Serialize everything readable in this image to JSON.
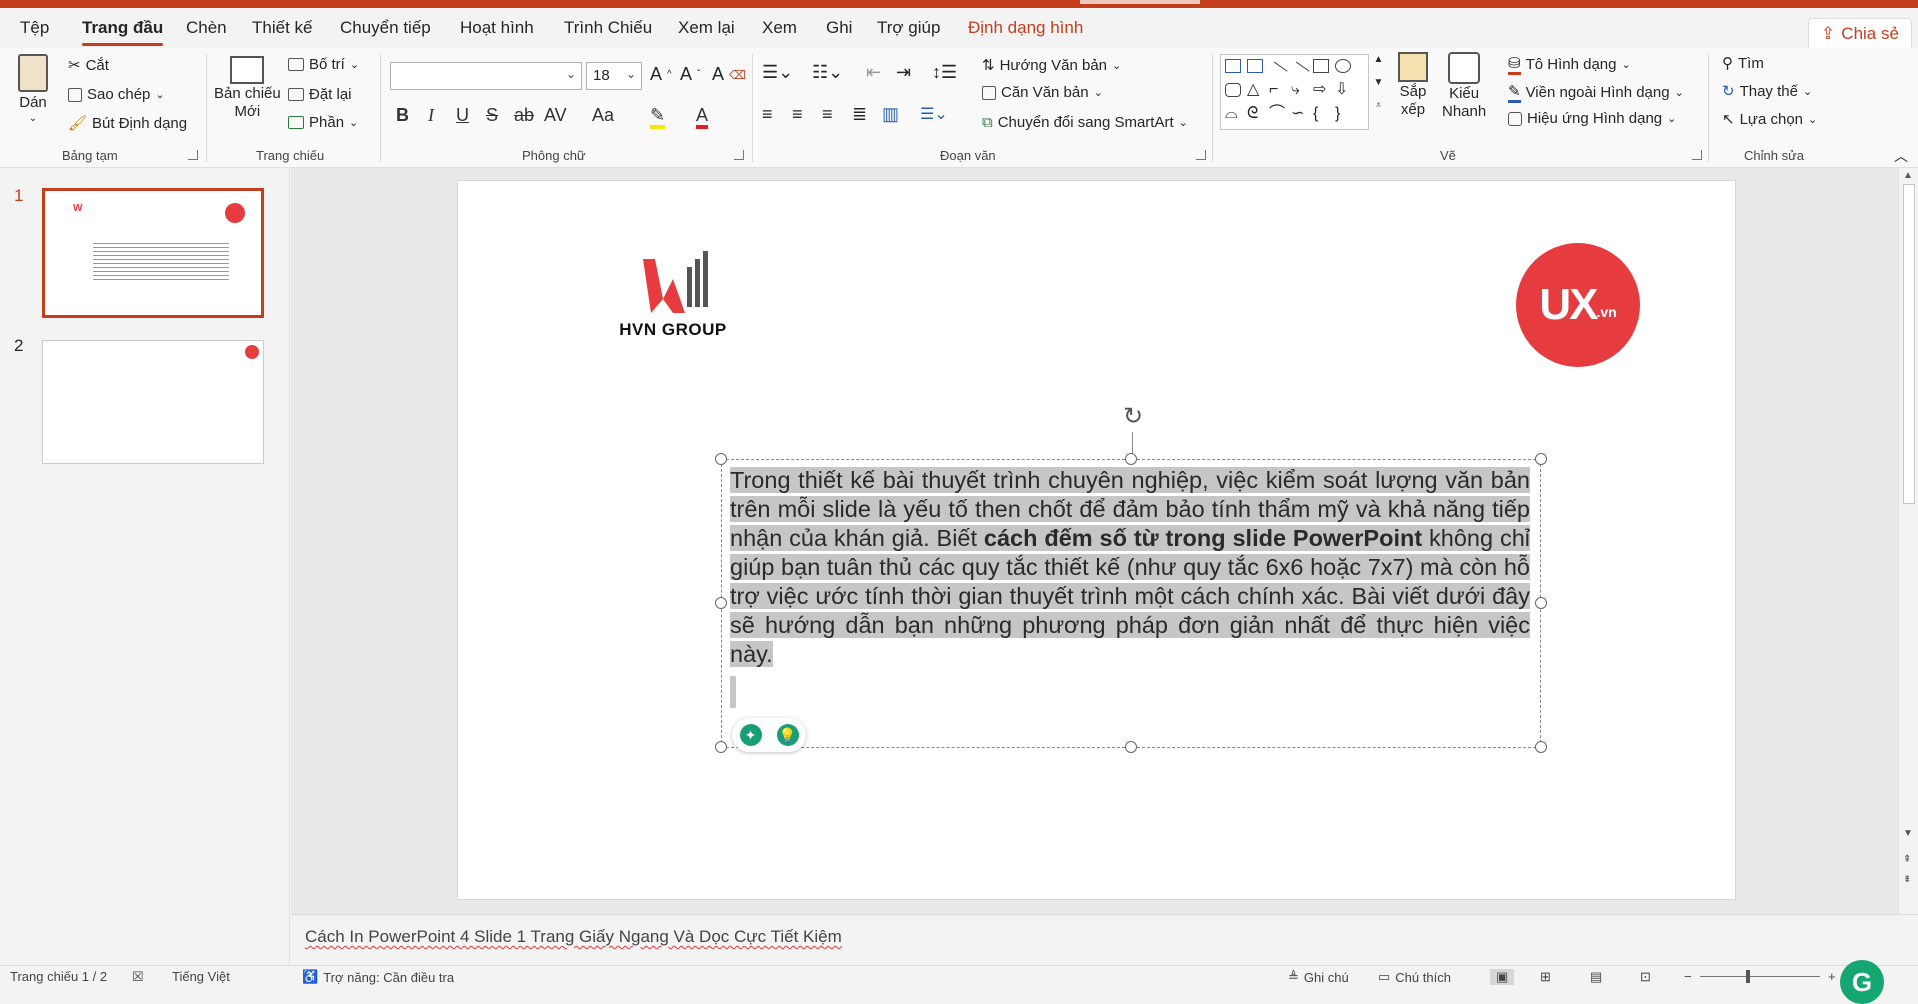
{
  "tabs": [
    "Tệp",
    "Trang đầu",
    "Chèn",
    "Thiết kế",
    "Chuyển tiếp",
    "Hoạt hình",
    "Trình Chiếu",
    "Xem lại",
    "Xem",
    "Ghi",
    "Trợ giúp",
    "Định dạng hình"
  ],
  "share_label": "Chia sẻ",
  "ribbon": {
    "clipboard": {
      "paste": "Dán",
      "cut": "Cắt",
      "copy": "Sao chép",
      "format_painter": "Bút Định dạng",
      "group": "Bảng tạm"
    },
    "slides": {
      "new_slide_1": "Bản chiếu",
      "new_slide_2": "Mới",
      "layout": "Bố trí",
      "reset": "Đặt lại",
      "section": "Phần",
      "group": "Trang chiếu"
    },
    "font": {
      "font_name": "",
      "font_size": "18",
      "bold": "B",
      "italic": "I",
      "underline": "U",
      "shadow": "S",
      "strike": "ab",
      "spacing": "AV",
      "case": "Aa",
      "group": "Phông chữ"
    },
    "paragraph": {
      "text_direction": "Hướng Văn bản",
      "align_text": "Căn Văn bản",
      "smartart": "Chuyển đổi sang SmartArt",
      "group": "Đoạn văn"
    },
    "drawing": {
      "arrange_1": "Sắp",
      "arrange_2": "xếp",
      "quick_1": "Kiểu",
      "quick_2": "Nhanh",
      "fill": "Tô Hình dạng",
      "outline": "Viền ngoài Hình dạng",
      "effects": "Hiệu ứng Hình dạng",
      "group": "Vẽ"
    },
    "editing": {
      "find": "Tìm",
      "replace": "Thay thế",
      "select": "Lựa chọn",
      "group": "Chỉnh sửa"
    }
  },
  "thumbnails": [
    {
      "number": "1",
      "selected": true
    },
    {
      "number": "2",
      "selected": false
    }
  ],
  "slide": {
    "logo_left": "HVN GROUP",
    "logo_right_main": "UX",
    "logo_right_suffix": ".vn",
    "text_parts": [
      "Trong thiết kế bài thuyết trình chuyên nghiệp, việc kiểm soát lượng văn bản trên mỗi slide là yếu tố then chốt để đảm bảo tính thẩm mỹ và khả năng tiếp nhận của khán giả. Biết ",
      "cách đếm số từ trong slide PowerPoint",
      " không chỉ giúp bạn tuân thủ các quy tắc thiết kế (như quy tắc 6x6 hoặc 7x7) mà còn hỗ trợ việc ước tính thời gian thuyết trình một cách chính xác. Bài viết dưới đây sẽ hướng dẫn bạn những phương pháp đơn giản nhất để thực hiện việc này."
    ]
  },
  "notes_text": "Cách In PowerPoint 4 Slide 1 Trang Giấy Ngang Và Dọc Cực Tiết Kiệm",
  "status": {
    "slide_counter": "Trang chiếu 1 / 2",
    "language": "Tiếng Việt",
    "accessibility": "Trợ năng: Cần điều tra",
    "notes": "Ghi chú",
    "comments": "Chú thích"
  },
  "colors": {
    "accent": "#c43e1c",
    "logo_red": "#e63b3f",
    "selection": "#c6c6c6"
  }
}
